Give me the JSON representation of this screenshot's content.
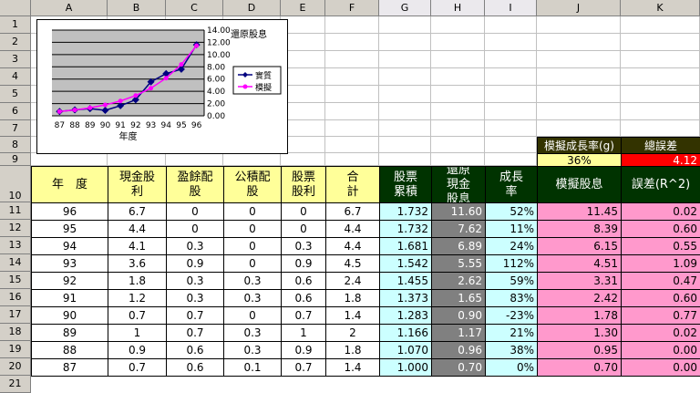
{
  "columns": [
    "A",
    "B",
    "C",
    "D",
    "E",
    "F",
    "G",
    "H",
    "I",
    "J",
    "K"
  ],
  "rows": [
    "1",
    "2",
    "3",
    "4",
    "5",
    "6",
    "7",
    "8",
    "9",
    "10",
    "11",
    "12",
    "13",
    "14",
    "15",
    "16",
    "17",
    "18",
    "19",
    "20",
    "21"
  ],
  "colors": {
    "yellow": "#ffff99",
    "cyan": "#ccffff",
    "gray": "#808080",
    "green": "#003300",
    "pink": "#ff99cc",
    "red": "#ff0000",
    "dark": "#333300"
  },
  "summary": {
    "growth_label": "模擬成長率(g)",
    "growth_value": "36%",
    "error_label": "總誤差",
    "error_value": "4.12"
  },
  "headers": [
    "年　度",
    "現金股利",
    "盈餘配股",
    "公積配股",
    "股票股利",
    "合　計",
    "股票累積",
    "還原現金股息",
    "成長率",
    "模擬股息",
    "誤差(R^2)"
  ],
  "table": [
    [
      "96",
      "6.7",
      "0",
      "0",
      "0",
      "6.7",
      "1.732",
      "11.60",
      "52%",
      "11.45",
      "0.02"
    ],
    [
      "95",
      "4.4",
      "0",
      "0",
      "0",
      "4.4",
      "1.732",
      "7.62",
      "11%",
      "8.39",
      "0.60"
    ],
    [
      "94",
      "4.1",
      "0.3",
      "0",
      "0.3",
      "4.4",
      "1.681",
      "6.89",
      "24%",
      "6.15",
      "0.55"
    ],
    [
      "93",
      "3.6",
      "0.9",
      "0",
      "0.9",
      "4.5",
      "1.542",
      "5.55",
      "112%",
      "4.51",
      "1.09"
    ],
    [
      "92",
      "1.8",
      "0.3",
      "0.3",
      "0.6",
      "2.4",
      "1.455",
      "2.62",
      "59%",
      "3.31",
      "0.47"
    ],
    [
      "91",
      "1.2",
      "0.3",
      "0.3",
      "0.6",
      "1.8",
      "1.373",
      "1.65",
      "83%",
      "2.42",
      "0.60"
    ],
    [
      "90",
      "0.7",
      "0.7",
      "0",
      "0.7",
      "1.4",
      "1.283",
      "0.90",
      "-23%",
      "1.78",
      "0.77"
    ],
    [
      "89",
      "1",
      "0.7",
      "0.3",
      "1",
      "2",
      "1.166",
      "1.17",
      "21%",
      "1.30",
      "0.02"
    ],
    [
      "88",
      "0.9",
      "0.6",
      "0.3",
      "0.9",
      "1.8",
      "1.070",
      "0.96",
      "38%",
      "0.95",
      "0.00"
    ],
    [
      "87",
      "0.7",
      "0.6",
      "0.1",
      "0.7",
      "1.4",
      "1.000",
      "0.70",
      "0%",
      "0.70",
      "0.00"
    ]
  ],
  "chart_data": {
    "type": "line",
    "title": "還原股息",
    "xlabel": "年度",
    "categories": [
      "87",
      "88",
      "89",
      "90",
      "91",
      "92",
      "93",
      "94",
      "95",
      "96"
    ],
    "yticks": [
      "0.00",
      "2.00",
      "4.00",
      "6.00",
      "8.00",
      "10.00",
      "12.00",
      "14.00"
    ],
    "ylim": [
      0,
      14
    ],
    "series": [
      {
        "name": "實質",
        "color": "#000080",
        "values": [
          0.7,
          0.96,
          1.17,
          0.9,
          1.65,
          2.62,
          5.55,
          6.89,
          7.62,
          11.6
        ]
      },
      {
        "name": "模擬",
        "color": "#ff00ff",
        "values": [
          0.7,
          0.95,
          1.3,
          1.78,
          2.42,
          3.31,
          4.51,
          6.15,
          8.39,
          11.45
        ]
      }
    ]
  }
}
